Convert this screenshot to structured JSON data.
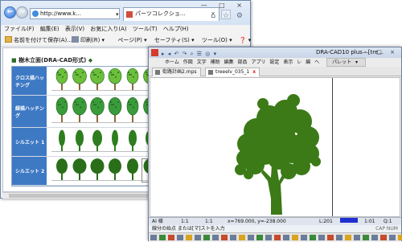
{
  "browser": {
    "address_url": "http://www.k...",
    "tab_title": "パーツコレクショ...",
    "tab_close": "×",
    "window_controls": "— □ ×",
    "menu": [
      "ファイル(F)",
      "編集(E)",
      "表示(V)",
      "お気に入り(A)",
      "ツール(T)",
      "ヘルプ(H)"
    ],
    "favorites_save_label": "名前を付けて保存(A)...",
    "command_bar": [
      "印刷(R) ▾",
      "ページ(P) ▾",
      "セーフティ(S) ▾",
      "ツール(O) ▾",
      "❓ ▾"
    ]
  },
  "page": {
    "title_bullet": "■",
    "title": "樹木立面(DRA-CAD形式)",
    "title_suffix": "◆",
    "categories": [
      {
        "label": "クロス描ハッチング",
        "color": "#6cbf3b",
        "style": "broadleaf"
      },
      {
        "label": "緑描ハッチング",
        "color": "#3a9b3a",
        "style": "broadleaf"
      },
      {
        "label": "シルエット 1",
        "color": "#2e7d1e",
        "style": "conifer"
      },
      {
        "label": "シルエット 2",
        "color": "#2a6e1a",
        "style": "broadleaf"
      }
    ]
  },
  "cad": {
    "title": "DRA-CAD10 plus - [tre...",
    "window_controls": "— □ ×",
    "quick_access": "▸ ◂ ↶ ↷ ⌕ ☰ ◎ ▾",
    "menu": [
      "ホ",
      "作",
      "文",
      "補",
      "編",
      "部",
      "ア",
      "設",
      "表",
      "ヘ"
    ],
    "menu_full": [
      "ホーム",
      "作図",
      "文字",
      "補助",
      "編集",
      "部品",
      "アプリ",
      "設定",
      "表示",
      "レ",
      "編",
      "ヘ"
    ],
    "palette_label": "パレット",
    "palette_arrow": "▾",
    "tabs": [
      {
        "label": "街路計画2.mps",
        "active": false
      },
      {
        "label": "treeelv_035_1",
        "active": true
      }
    ],
    "tab_close": "x",
    "status": {
      "layer": "AI 様",
      "scale1": "1:1",
      "scale2": "1:1",
      "coords": "x=769.000, y=-238.000",
      "l_value": "L:201",
      "ratio": "1:01",
      "q_value": "Q:1"
    },
    "prompt": "線分の始点 または[マ]ストを入力",
    "right_status": "CAP  NUM"
  },
  "colors": {
    "tree_green": "#3b7a17",
    "accent_blue": "#3e79c4"
  }
}
